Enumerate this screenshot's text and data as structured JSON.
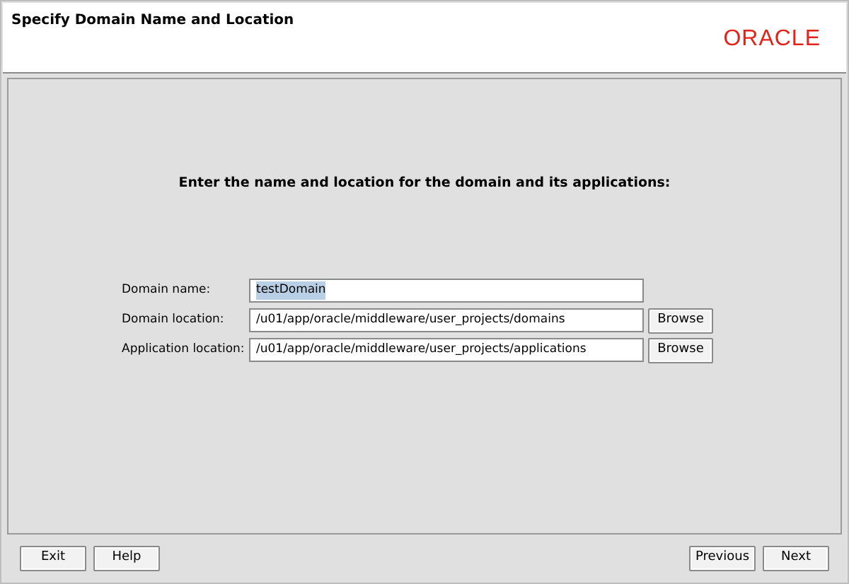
{
  "header": {
    "title": "Specify Domain Name and Location",
    "logo": "ORACLE"
  },
  "instruction": "Enter the name and location for the domain and its applications:",
  "fields": [
    {
      "label": "Domain name:",
      "value": "testDomain",
      "selected": true
    },
    {
      "label": "Domain location:",
      "value": "/u01/app/oracle/middleware/user_projects/domains",
      "selected": false,
      "button": "Browse"
    },
    {
      "label": "Application location:",
      "value": "/u01/app/oracle/middleware/user_projects/applications",
      "selected": false,
      "button": "Browse"
    }
  ],
  "left_buttons": [
    "Exit",
    "Help"
  ],
  "right_buttons": [
    "Previous",
    "Next"
  ]
}
